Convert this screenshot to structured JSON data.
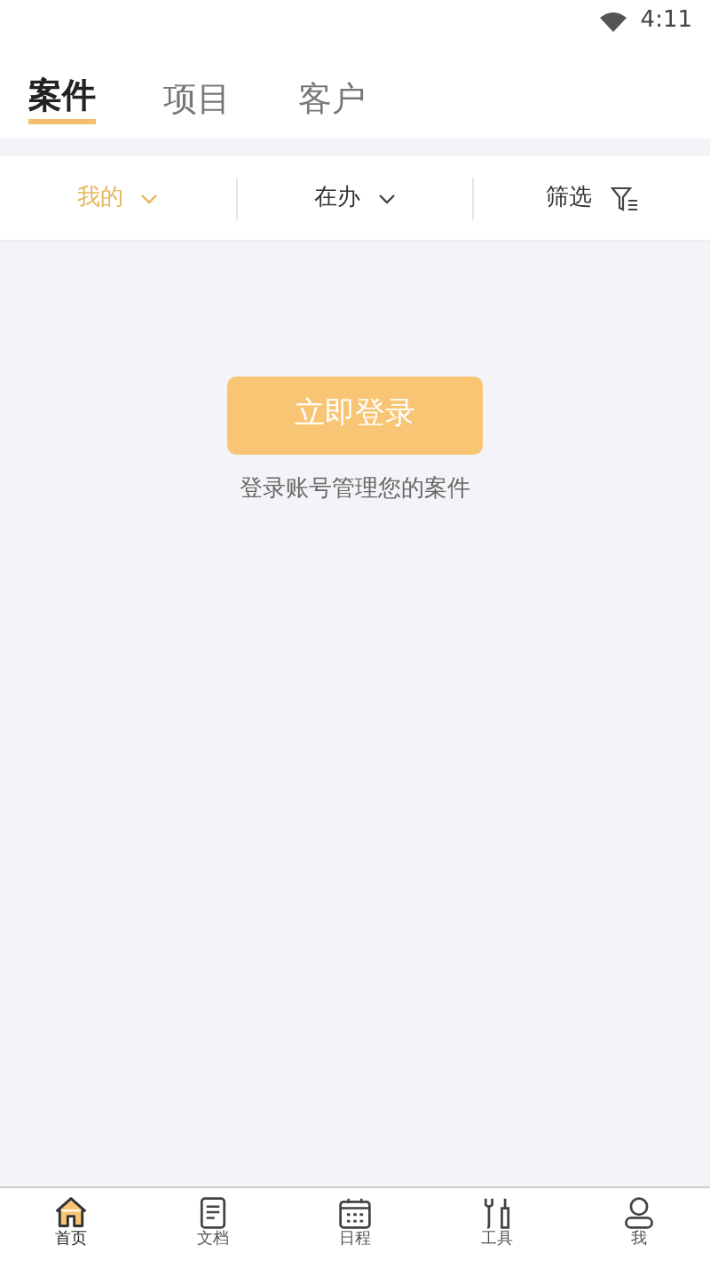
{
  "status_bar": {
    "time": "4:11"
  },
  "tabs": [
    {
      "label": "案件",
      "selected": true
    },
    {
      "label": "项目",
      "selected": false
    },
    {
      "label": "客户",
      "selected": false
    }
  ],
  "filters": [
    {
      "label": "我的",
      "kind": "dropdown",
      "selected": true
    },
    {
      "label": "在办",
      "kind": "dropdown",
      "selected": false
    },
    {
      "label": "筛选",
      "kind": "filter",
      "selected": false
    }
  ],
  "empty_state": {
    "button": "立即登录",
    "message": "登录账号管理您的案件"
  },
  "bottom_nav": [
    {
      "label": "首页",
      "kind": "home",
      "selected": true
    },
    {
      "label": "文档",
      "kind": "document",
      "selected": false
    },
    {
      "label": "日程",
      "kind": "calendar",
      "selected": false
    },
    {
      "label": "工具",
      "kind": "tools",
      "selected": false
    },
    {
      "label": "我",
      "kind": "profile",
      "selected": false
    }
  ]
}
